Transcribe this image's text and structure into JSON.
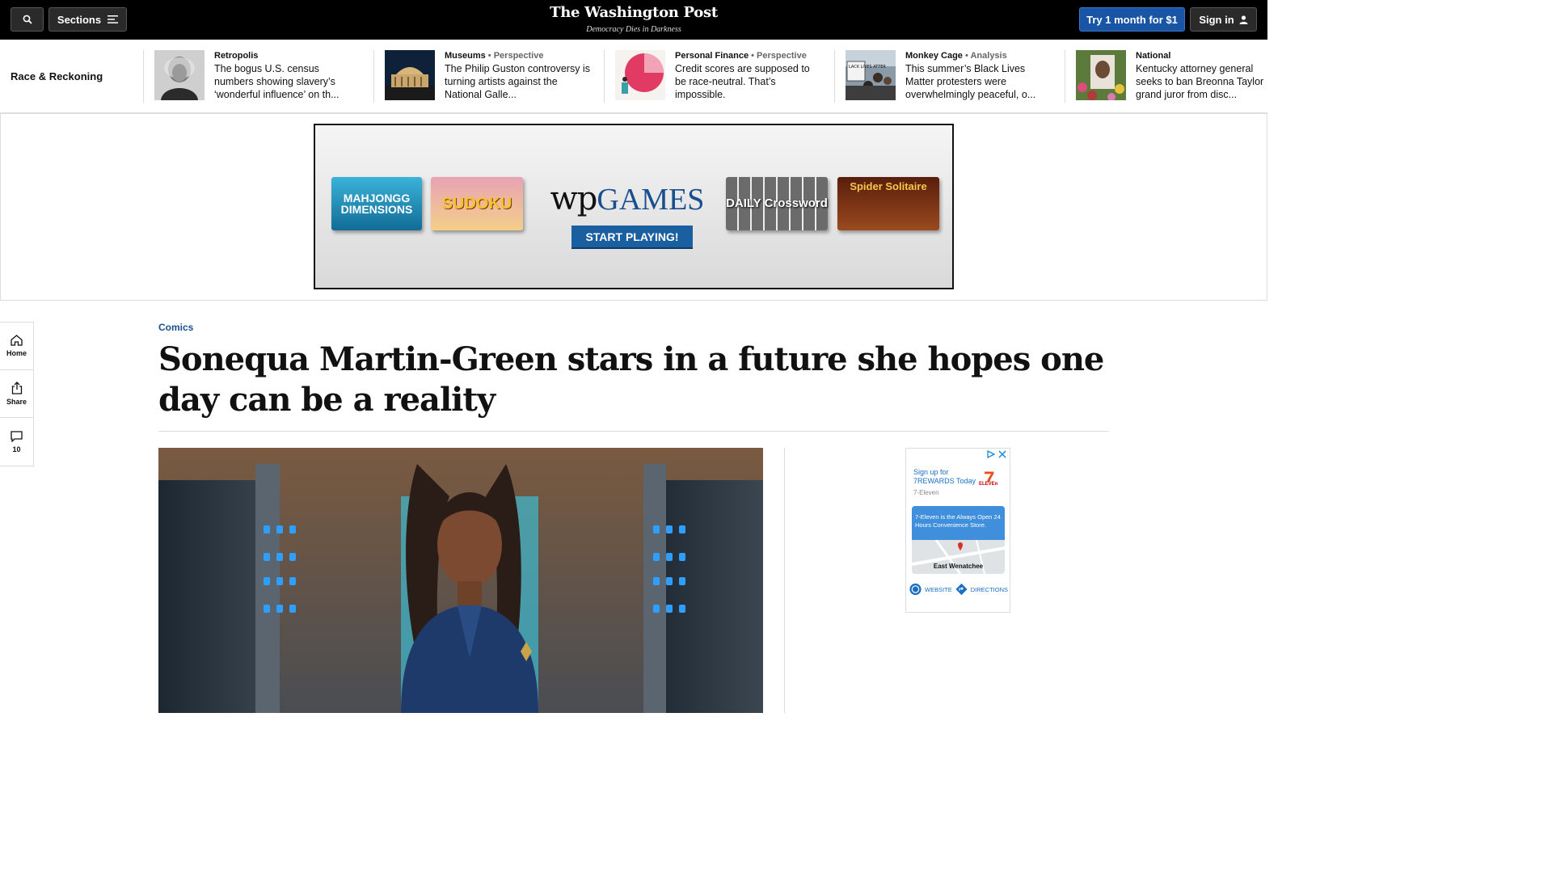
{
  "header": {
    "sections_label": "Sections",
    "logo": "The Washington Post",
    "tagline": "Democracy Dies in Darkness",
    "trial_label": "Try 1 month for $1",
    "signin_label": "Sign in"
  },
  "hub": {
    "title": "Race & Reckoning",
    "cards": [
      {
        "kicker": "Retropolis",
        "label": "",
        "headline": "The bogus U.S. census numbers showing slavery’s ‘wonderful influence’ on th..."
      },
      {
        "kicker": "Museums",
        "label": " • Perspective",
        "headline": "The Philip Guston controversy is turning artists against the National Galle..."
      },
      {
        "kicker": "Personal Finance",
        "label": " • Perspective",
        "headline": "Credit scores are supposed to be race-neutral. That’s impossible."
      },
      {
        "kicker": "Monkey Cage",
        "label": " • Analysis",
        "headline": "This summer’s Black Lives Matter protesters were overwhelmingly peaceful, o..."
      },
      {
        "kicker": "National",
        "label": "",
        "headline": "Kentucky attorney general seeks to ban Breonna Taylor grand juror from disc..."
      }
    ],
    "thumb_sign_text": "LACK LIVES ATTER"
  },
  "ad_banner": {
    "tiles": [
      "MAHJONGG DIMENSIONS",
      "SUDOKU",
      "DAILY Crossword",
      "Spider Solitaire"
    ],
    "brand_wp": "wp",
    "brand_games": "GAMES",
    "cta": "START PLAYING!"
  },
  "rail": {
    "home_label": "Home",
    "share_label": "Share",
    "comments_count": "10"
  },
  "article": {
    "kicker": "Comics",
    "headline": "Sonequa Martin-Green stars in a future she hopes one day can be a reality"
  },
  "side_ad": {
    "title": "Sign up for 7REWARDS Today",
    "brand": "7-Eleven",
    "logo_text": "ELEVEn",
    "promo": "7-Eleven is the Always Open 24 Hours Convenience Store.",
    "map_label": "East Wenatchee",
    "website_label": "WEBSITE",
    "directions_label": "DIRECTIONS"
  },
  "colors": {
    "topbar": "#000000",
    "accent_blue": "#1955a5",
    "kicker_blue": "#1a4f8f"
  }
}
